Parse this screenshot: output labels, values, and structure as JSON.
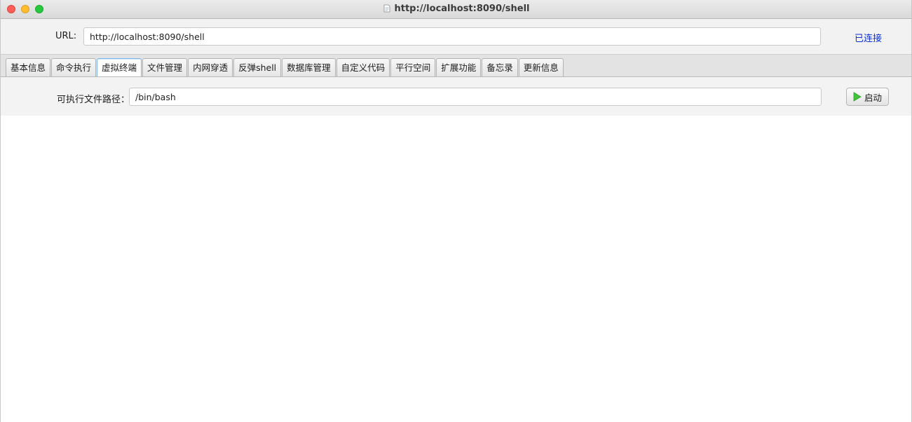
{
  "window": {
    "title": "http://localhost:8090/shell",
    "title_icon": "document-icon"
  },
  "url_row": {
    "label": "URL:",
    "value": "http://localhost:8090/shell",
    "status": "已连接",
    "status_color": "#0b2fd6"
  },
  "tabs": [
    {
      "label": "基本信息",
      "active": false
    },
    {
      "label": "命令执行",
      "active": false
    },
    {
      "label": "虚拟终端",
      "active": true
    },
    {
      "label": "文件管理",
      "active": false
    },
    {
      "label": "内网穿透",
      "active": false
    },
    {
      "label": "反弹shell",
      "active": false
    },
    {
      "label": "数据库管理",
      "active": false
    },
    {
      "label": "自定义代码",
      "active": false
    },
    {
      "label": "平行空间",
      "active": false
    },
    {
      "label": "扩展功能",
      "active": false
    },
    {
      "label": "备忘录",
      "active": false
    },
    {
      "label": "更新信息",
      "active": false
    }
  ],
  "terminal": {
    "path_label": "可执行文件路径：",
    "path_value": "/bin/bash",
    "start_button_label": "启动",
    "start_button_icon": "play-icon",
    "play_icon_color": "#3fc43a"
  }
}
